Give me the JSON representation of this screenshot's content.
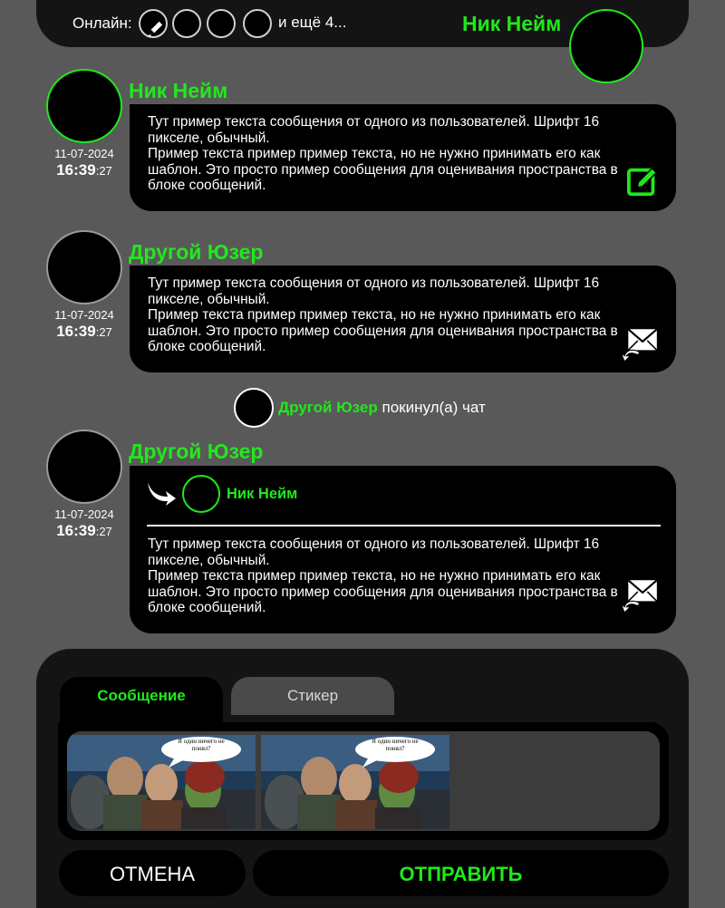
{
  "header": {
    "online_label": "Онлайн:",
    "online_more": "и ещё 4...",
    "current_user": "Ник Нейм"
  },
  "messages": [
    {
      "author": "Ник Нейм",
      "date": "11-07-2024",
      "time_hm": "16:39",
      "time_sec": ":27",
      "text": "Тут пример текста сообщения от одного из пользователей. Шрифт 16 пикселе, обычный.\nПример текста пример пример текста, но не нужно принимать его как шаблон. Это просто пример сообщения для оценивания пространства в блоке сообщений.",
      "action_icon": "edit-icon"
    },
    {
      "author": "Другой Юзер",
      "date": "11-07-2024",
      "time_hm": "16:39",
      "time_sec": ":27",
      "text": "Тут пример текста сообщения от одного из пользователей. Шрифт 16 пикселе, обычный.\nПример текста пример пример текста, но не нужно принимать его как шаблон. Это просто пример сообщения для оценивания пространства в блоке сообщений.",
      "action_icon": "reply-mail-icon"
    },
    {
      "author": "Другой Юзер",
      "date": "11-07-2024",
      "time_hm": "16:39",
      "time_sec": ":27",
      "reply_to": "Ник Нейм",
      "text": "Тут пример текста сообщения от одного из пользователей. Шрифт 16 пикселе, обычный.\nПример текста пример пример текста, но не нужно принимать его как шаблон. Это просто пример сообщения для оценивания пространства в блоке сообщений.",
      "action_icon": "reply-mail-icon"
    }
  ],
  "system_message": {
    "user": "Другой Юзер",
    "text": "покинул(а) чат"
  },
  "composer": {
    "tab_message": "Сообщение",
    "tab_sticker": "Стикер",
    "sticker_bubble_text": "Я один ничего не понял?",
    "cancel_label": "ОТМЕНА",
    "send_label": "ОТПРАВИТЬ"
  },
  "colors": {
    "accent": "#21e81c",
    "background": "#595959",
    "panel": "#141414",
    "bubble": "#000000"
  }
}
